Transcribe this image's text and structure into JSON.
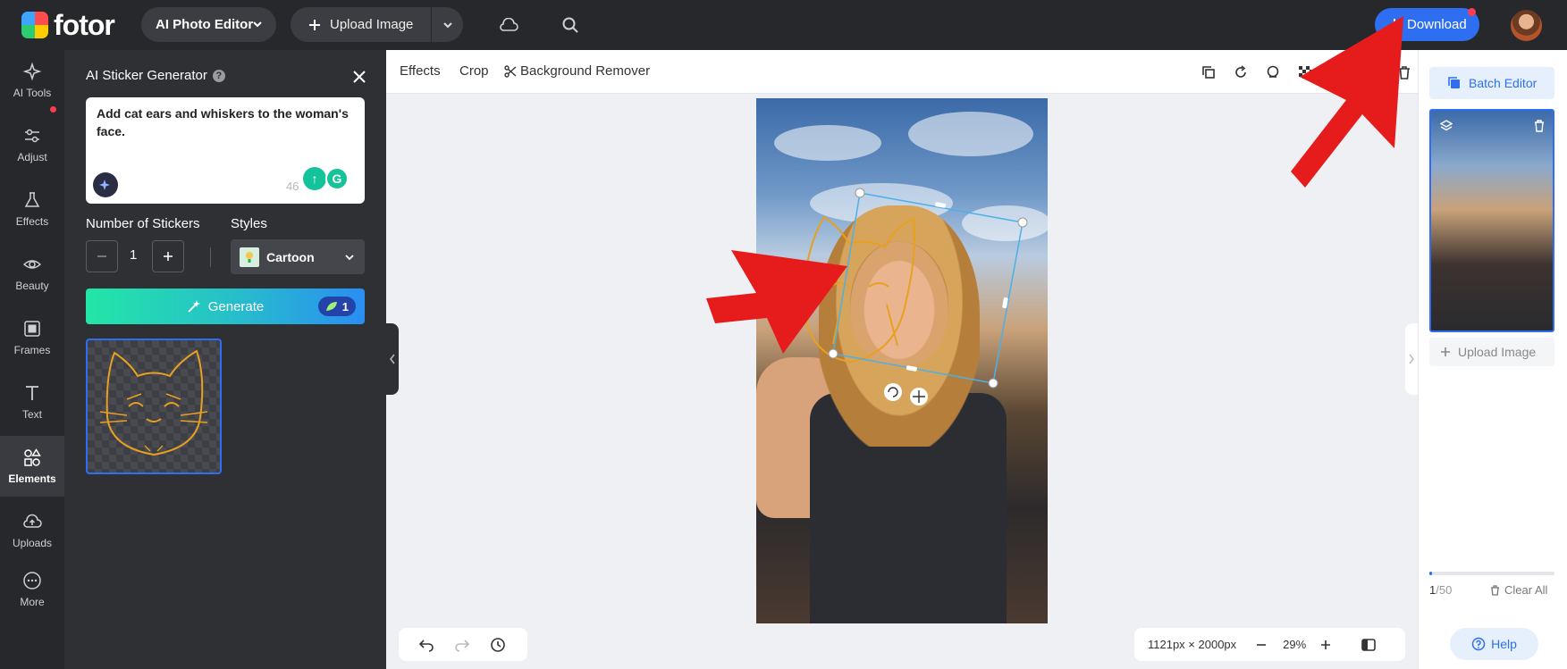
{
  "app": {
    "logo_text": "fotor"
  },
  "topbar": {
    "ai_editor_label": "AI Photo Editor",
    "upload_label": "Upload Image",
    "download_label": "Download"
  },
  "rail": {
    "items": [
      {
        "label": "AI Tools",
        "icon": "sparkles-icon"
      },
      {
        "label": "Adjust",
        "icon": "sliders-icon"
      },
      {
        "label": "Effects",
        "icon": "flask-icon"
      },
      {
        "label": "Beauty",
        "icon": "eye-icon"
      },
      {
        "label": "Frames",
        "icon": "frame-icon"
      },
      {
        "label": "Text",
        "icon": "text-icon"
      },
      {
        "label": "Elements",
        "icon": "shapes-icon",
        "active": true
      },
      {
        "label": "Uploads",
        "icon": "cloud-upload-icon"
      },
      {
        "label": "More",
        "icon": "more-icon"
      }
    ]
  },
  "panel": {
    "title": "AI Sticker Generator",
    "prompt": "Add cat ears and whiskers to the woman's face.",
    "char_count": "46",
    "number_label": "Number of Stickers",
    "number_value": "1",
    "styles_label": "Styles",
    "style_value": "Cartoon",
    "generate_label": "Generate",
    "credits": "1"
  },
  "toolbar": {
    "effects": "Effects",
    "crop": "Crop",
    "background_remover": "Background Remover"
  },
  "canvas": {
    "dimensions": "1121px × 2000px",
    "zoom": "29%"
  },
  "right_panel": {
    "batch_editor": "Batch Editor",
    "upload_label": "Upload Image",
    "count_current": "1",
    "count_total": "/50",
    "progress": 0.02,
    "clear_all": "Clear All",
    "help": "Help"
  },
  "colors": {
    "accent": "#2d6ff0",
    "annotation_arrow": "#e61c1c",
    "sticker_line": "#e8a020",
    "selection": "#4cb0e8"
  }
}
